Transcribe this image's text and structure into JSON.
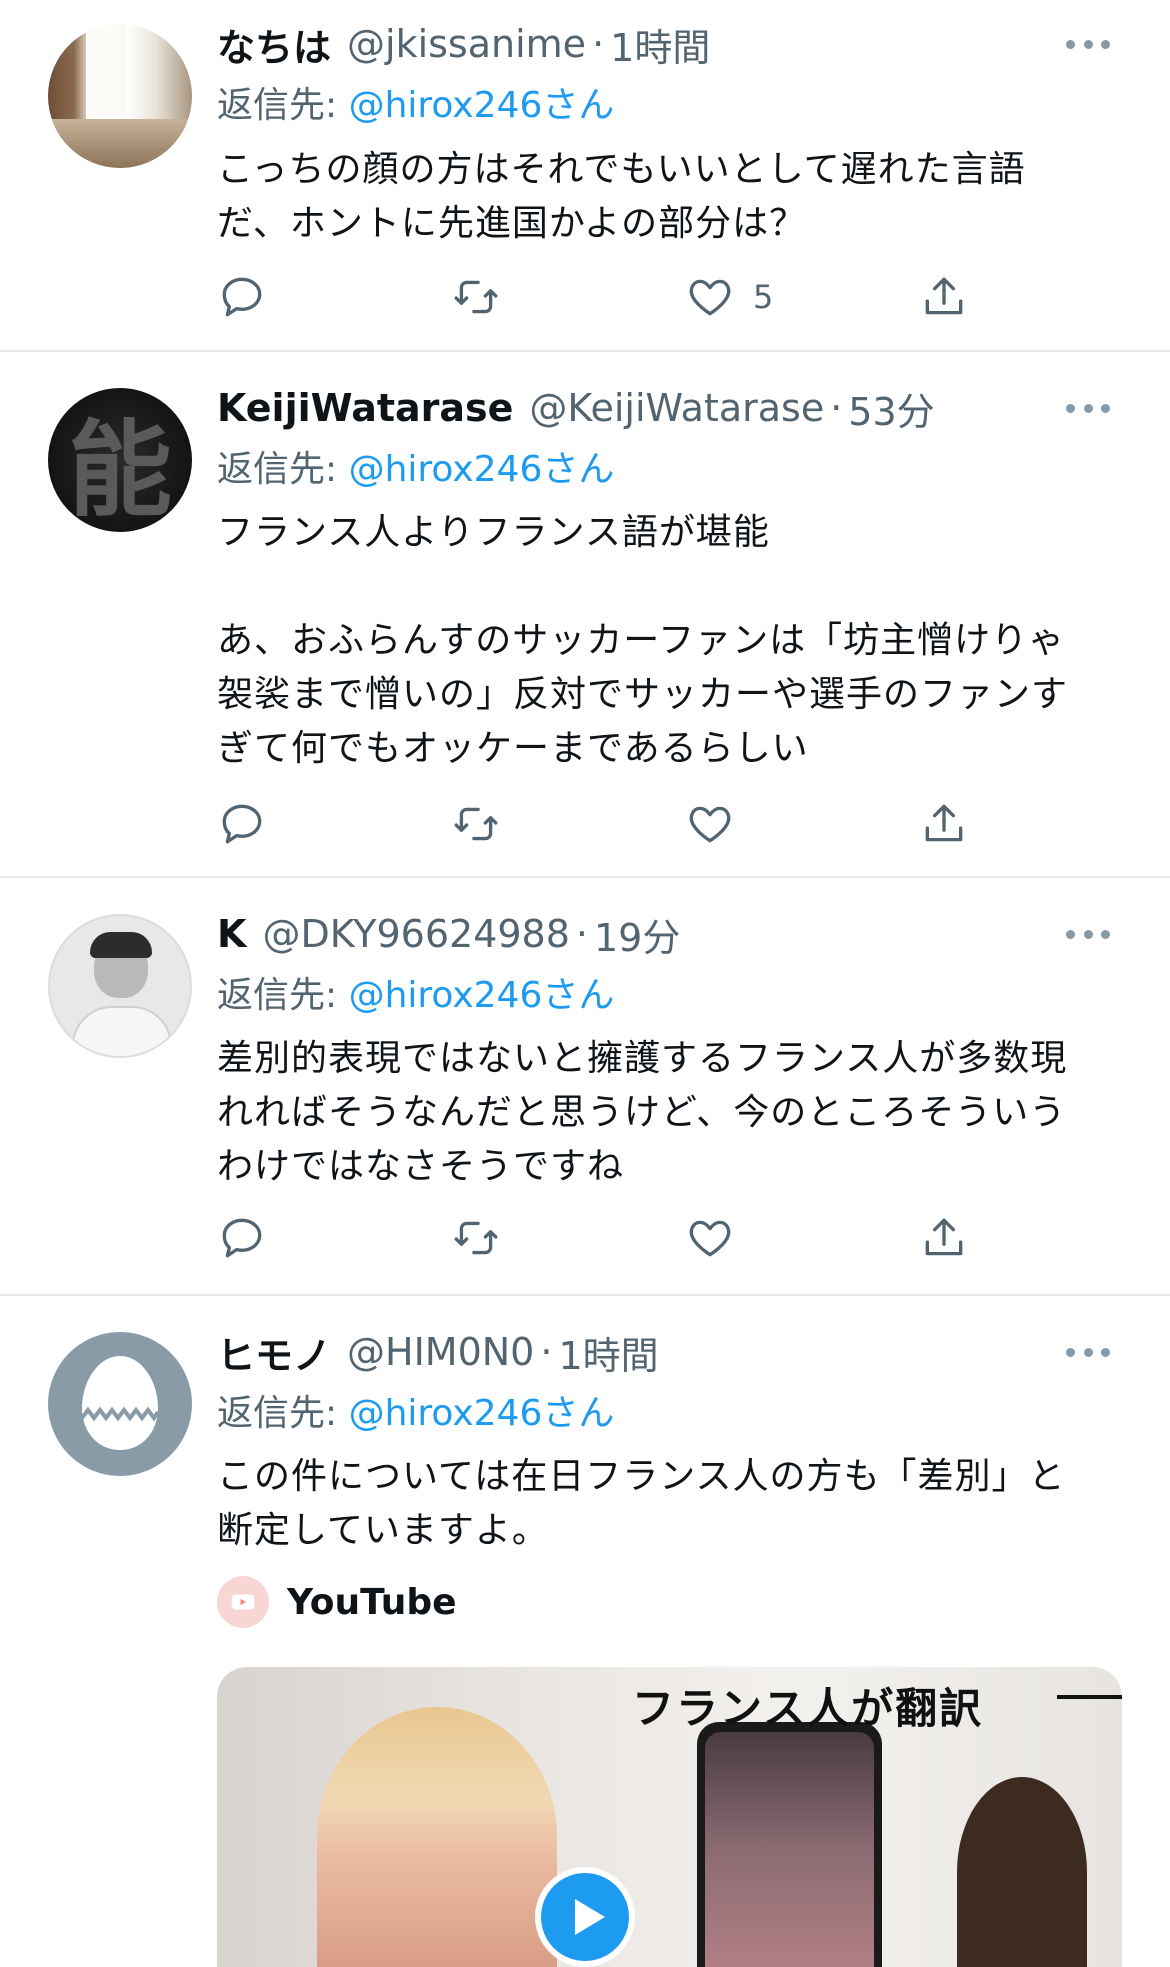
{
  "tweets": [
    {
      "name": "なちは",
      "handle": "@jkissanime",
      "dot": "·",
      "time": "1時間",
      "reply_prefix": "返信先:",
      "reply_to": "@hirox246さん",
      "lines": [
        "こっちの顔の方はそれでもいいとして遅れた言語",
        "だ、ホントに先進国かよの部分は？"
      ],
      "like_count": "5"
    },
    {
      "name": "KeijiWatarase",
      "handle": "@KeijiWatarase",
      "dot": "·",
      "time": "53分",
      "reply_prefix": "返信先:",
      "reply_to": "@hirox246さん",
      "lines": [
        "フランス人よりフランス語が堪能",
        "",
        "あ、おふらんすのサッカーファンは「坊主憎けりゃ",
        "袈裟まで憎いの」反対でサッカーや選手のファンす",
        "ぎて何でもオッケーまであるらしい"
      ],
      "avatar_glyph": "能"
    },
    {
      "name": "K",
      "handle": "@DKY96624988",
      "dot": "·",
      "time": "19分",
      "reply_prefix": "返信先:",
      "reply_to": "@hirox246さん",
      "lines": [
        "差別的表現ではないと擁護するフランス人が多数現",
        "れればそうなんだと思うけど、今のところそういう",
        "わけではなさそうですね"
      ]
    },
    {
      "name": "ヒモノ",
      "handle": "@HIM0N0",
      "dot": "·",
      "time": "1時間",
      "reply_prefix": "返信先:",
      "reply_to": "@hirox246さん",
      "lines": [
        "この件については在日フランス人の方も「差別」と",
        "断定していますよ。"
      ],
      "card_source": "YouTube",
      "card_title": "フランス人が翻訳"
    }
  ],
  "icons": {
    "more": "more-dots-icon",
    "reply": "reply-icon",
    "retweet": "retweet-icon",
    "like": "heart-icon",
    "share": "share-icon",
    "play": "play-icon"
  },
  "colors": {
    "link": "#1d9bf0",
    "secondary": "#536471",
    "divider": "#e6e9ec",
    "icon": "#536471"
  }
}
